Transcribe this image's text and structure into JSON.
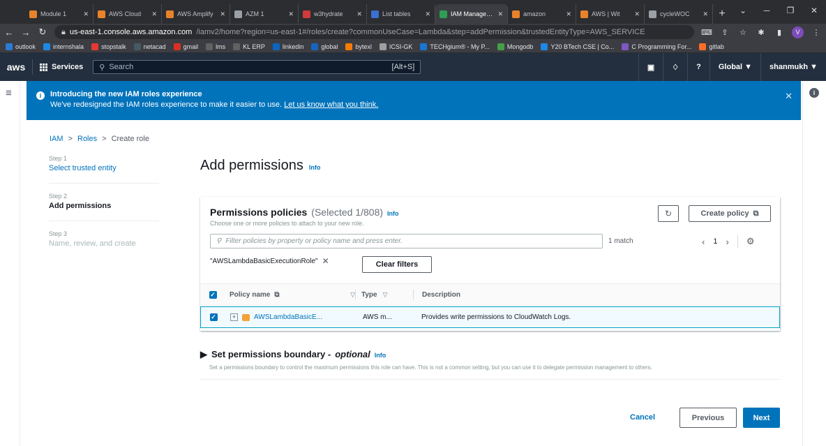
{
  "browser": {
    "tabs": [
      {
        "label": "Module 1",
        "color": "#e8832a"
      },
      {
        "label": "AWS Cloud",
        "color": "#e8832a"
      },
      {
        "label": "AWS Amplify",
        "color": "#e8832a"
      },
      {
        "label": "AZM 1",
        "color": "#9aa0a6"
      },
      {
        "label": "w3hydrate",
        "color": "#d03b3b"
      },
      {
        "label": "List tables",
        "color": "#3b6fd0"
      },
      {
        "label": "IAM Management",
        "color": "#2e9e55",
        "active": true
      },
      {
        "label": "amazon",
        "color": "#e8832a"
      },
      {
        "label": "AWS | Wit",
        "color": "#e8832a"
      },
      {
        "label": "cycleWOC",
        "color": "#9aa0a6"
      }
    ],
    "url_host": "us-east-1.console.aws.amazon.com",
    "url_path": "/iamv2/home?region=us-east-1#/roles/create?commonUseCase=Lambda&step=addPermission&trustedEntityType=AWS_SERVICE",
    "profile_initial": "V",
    "bookmarks": [
      {
        "label": "outlook",
        "color": "#2b7bd6"
      },
      {
        "label": "internshala",
        "color": "#1e88e5"
      },
      {
        "label": "stopstalk",
        "color": "#e53935"
      },
      {
        "label": "netacad",
        "color": "#455a64"
      },
      {
        "label": "gmail",
        "color": "#d93025"
      },
      {
        "label": "lms",
        "color": "#616161"
      },
      {
        "label": "KL ERP",
        "color": "#616161"
      },
      {
        "label": "linkedin",
        "color": "#0a66c2"
      },
      {
        "label": "global",
        "color": "#1565c0"
      },
      {
        "label": "bytexl",
        "color": "#f57c00"
      },
      {
        "label": "ICSI-GK",
        "color": "#9e9e9e"
      },
      {
        "label": "TECHgium® - My P...",
        "color": "#1976d2"
      },
      {
        "label": "Mongodb",
        "color": "#43a047"
      },
      {
        "label": "Y20 BTech CSE | Co...",
        "color": "#1e88e5"
      },
      {
        "label": "C Programming For...",
        "color": "#7e57c2"
      },
      {
        "label": "gitlab",
        "color": "#fc6d26"
      }
    ]
  },
  "aws_nav": {
    "logo": "aws",
    "services": "Services",
    "search_placeholder": "Search",
    "search_hint": "[Alt+S]",
    "region": "Global ▼",
    "account": "shanmukh ▼"
  },
  "banner": {
    "title": "Introducing the new IAM roles experience",
    "text": "We've redesigned the IAM roles experience to make it easier to use.",
    "link": "Let us know what you think."
  },
  "breadcrumb": [
    "IAM",
    "Roles",
    "Create role"
  ],
  "steps": [
    {
      "label": "Step 1",
      "name": "Select trusted entity",
      "state": "done"
    },
    {
      "label": "Step 2",
      "name": "Add permissions",
      "state": "current"
    },
    {
      "label": "Step 3",
      "name": "Name, review, and create",
      "state": "disabled"
    }
  ],
  "page": {
    "title": "Add permissions",
    "info": "Info"
  },
  "policies": {
    "title": "Permissions policies",
    "count": "(Selected 1/808)",
    "info": "Info",
    "desc": "Choose one or more policies to attach to your new role.",
    "create_policy": "Create policy",
    "filter_placeholder": "Filter policies by property or policy name and press enter.",
    "match": "1 match",
    "page": "1",
    "token": "\"AWSLambdaBasicExecutionRole\"",
    "clear_filters": "Clear filters",
    "columns": {
      "name": "Policy name",
      "type": "Type",
      "desc": "Description"
    },
    "rows": [
      {
        "name": "AWSLambdaBasicE...",
        "type": "AWS m...",
        "desc": "Provides write permissions to CloudWatch Logs.",
        "selected": true
      }
    ]
  },
  "boundary": {
    "title": "Set permissions boundary -",
    "optional": "optional",
    "info": "Info",
    "desc": "Set a permissions boundary to control the maximum permissions this role can have. This is not a common setting, but you can use it to delegate permission management to others."
  },
  "footer": {
    "cancel": "Cancel",
    "previous": "Previous",
    "next": "Next"
  }
}
